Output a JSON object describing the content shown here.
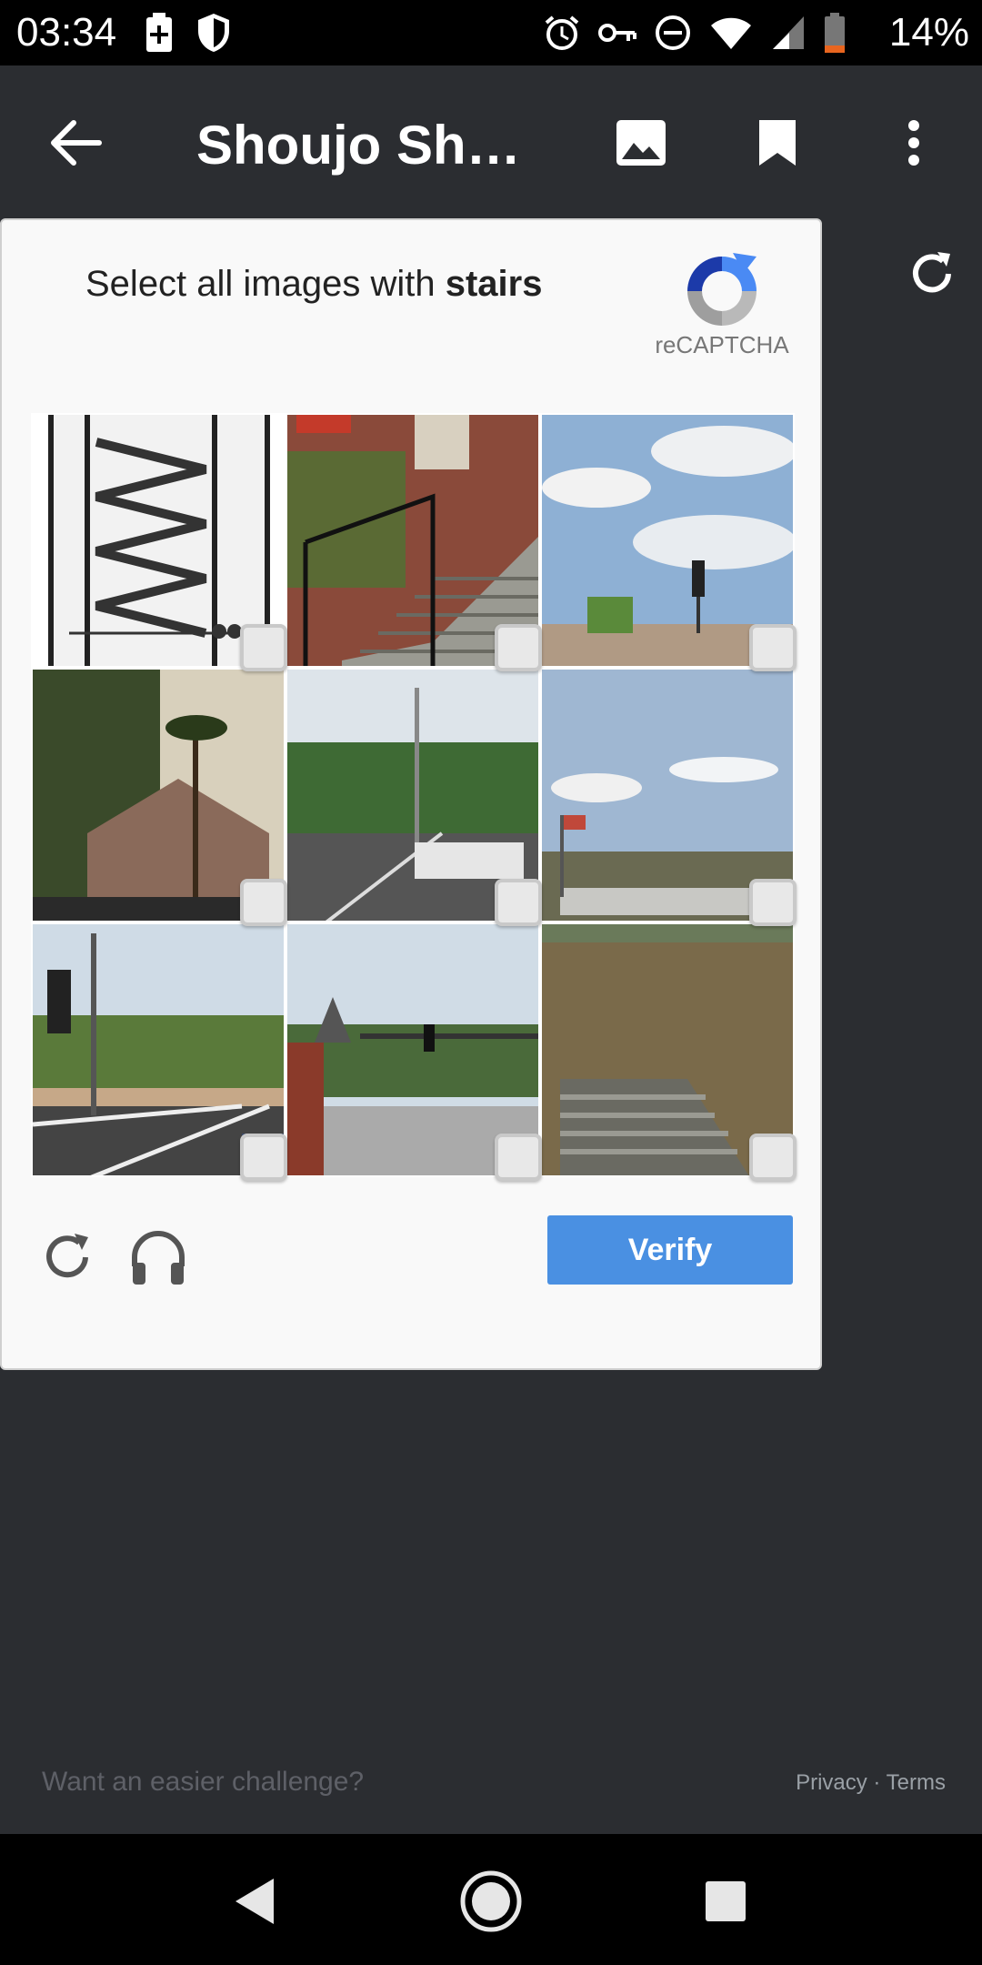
{
  "status_bar": {
    "time": "03:34",
    "battery_percent": "14%",
    "icons_left": [
      "battery-saver-icon",
      "shield-icon"
    ],
    "icons_right": [
      "alarm-icon",
      "vpn-key-icon",
      "do-not-disturb-icon",
      "wifi-icon",
      "signal-icon",
      "battery-icon"
    ]
  },
  "app_bar": {
    "title": "Shoujo Shuu...",
    "back_icon": "arrow-back-icon",
    "actions": [
      "image-icon",
      "bookmark-icon",
      "more-vert-icon"
    ]
  },
  "captcha": {
    "prompt_prefix": "Select all images with ",
    "prompt_target": "stairs",
    "brand": "reCAPTCHA",
    "tiles": [
      {
        "label": "Spiral staircase sketch"
      },
      {
        "label": "Brick stoop with stairs"
      },
      {
        "label": "Sky with traffic light"
      },
      {
        "label": "House with palm trees"
      },
      {
        "label": "Street with palm trees"
      },
      {
        "label": "Sky with flag and parking"
      },
      {
        "label": "Intersection with traffic lights"
      },
      {
        "label": "Street with tower"
      },
      {
        "label": "Grass field with steps"
      }
    ],
    "verify_label": "Verify",
    "reload_icon": "reload-icon",
    "audio_icon": "headphones-icon"
  },
  "footer": {
    "easier_challenge": "Want an easier challenge?",
    "privacy": "Privacy",
    "separator": " · ",
    "terms": "Terms"
  },
  "nav_bar": {
    "buttons": [
      "nav-back-icon",
      "nav-home-icon",
      "nav-recents-icon"
    ]
  }
}
